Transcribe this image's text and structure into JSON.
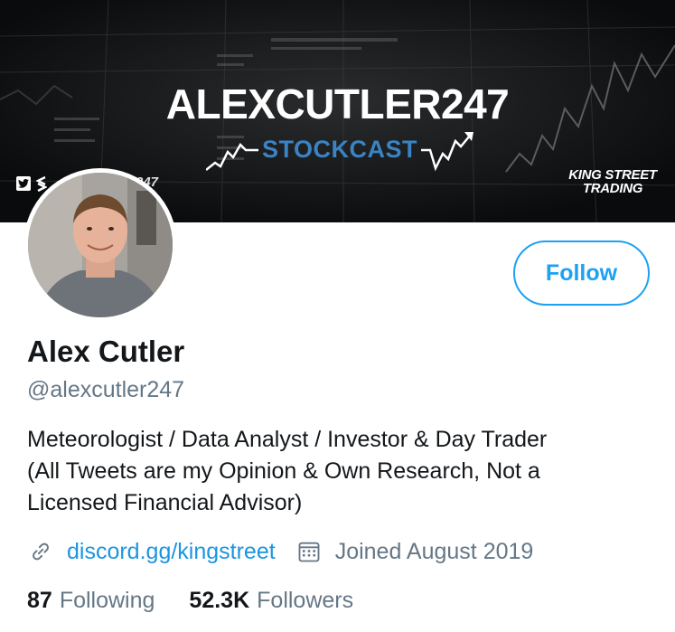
{
  "banner": {
    "title": "ALEXCUTLER247",
    "subtitle": "STOCKCAST",
    "handle_fragment": "247",
    "brand_line1": "KING STREET",
    "brand_line2": "TRADING",
    "colors": {
      "background": "#0c0d0e",
      "subtitle": "#3a83c4"
    }
  },
  "profile": {
    "display_name": "Alex Cutler",
    "handle": "@alexcutler247",
    "follow_label": "Follow",
    "bio_lines": [
      "Meteorologist / Data Analyst / Investor & Day Trader",
      "(All Tweets are my Opinion & Own Research, Not a",
      "Licensed Financial Advisor)"
    ],
    "link_text": "discord.gg/kingstreet",
    "joined_text": "Joined August 2019",
    "icons": {
      "link": "link-icon",
      "calendar": "calendar-icon"
    }
  },
  "stats": {
    "following_count": "87",
    "following_label": "Following",
    "followers_count": "52.3K",
    "followers_label": "Followers"
  },
  "theme": {
    "accent": "#1da1f2",
    "link": "#1b95e0",
    "muted": "#657786",
    "text": "#14171a"
  }
}
